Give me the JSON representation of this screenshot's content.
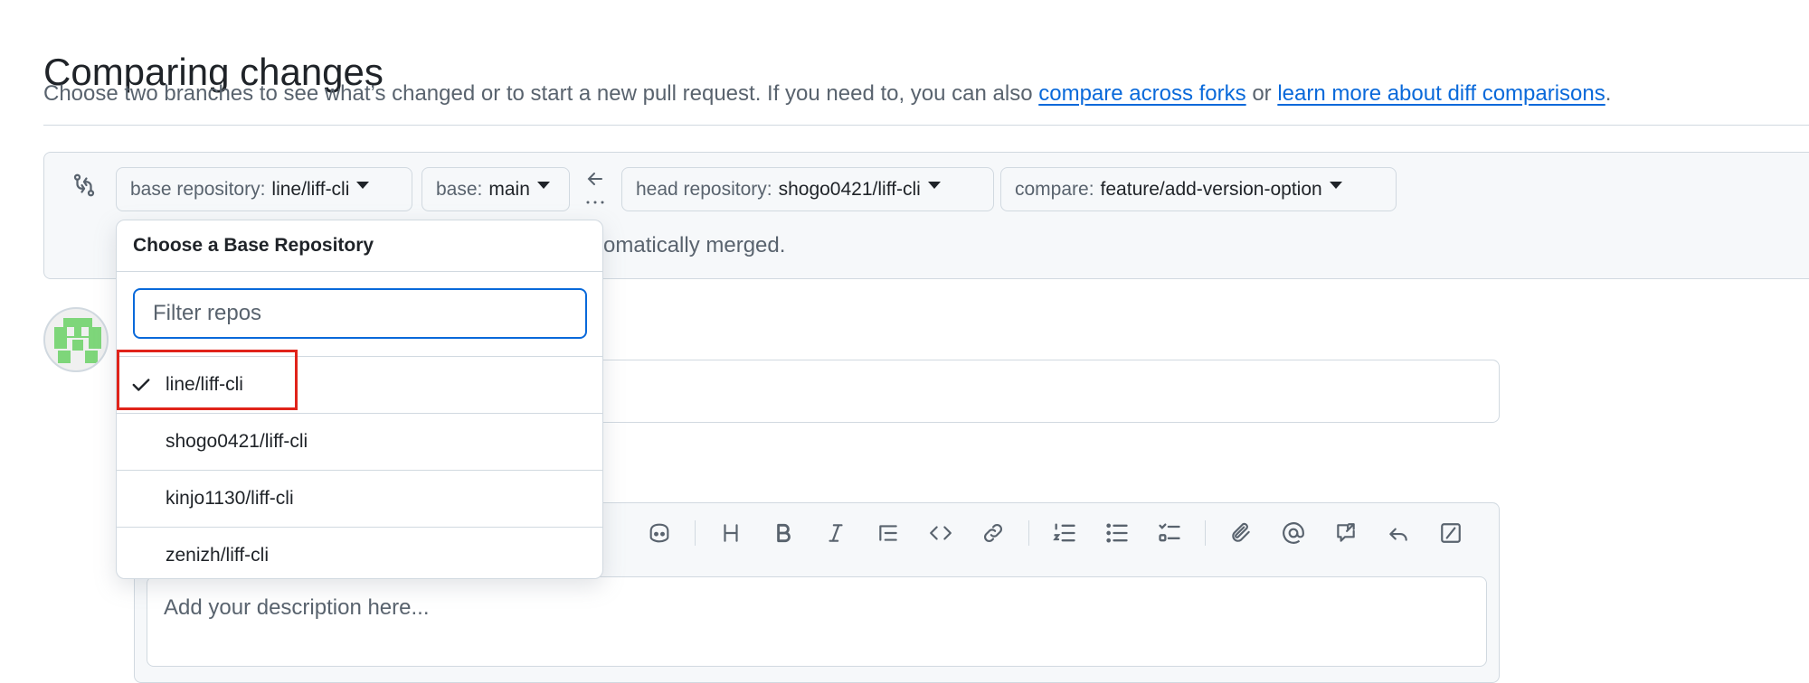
{
  "page": {
    "title": "Comparing changes",
    "subtitle_text": "Choose two branches to see what’s changed or to start a new pull request. If you need to, you can also",
    "link_forks": "compare across forks",
    "subtitle_or": "or",
    "link_learn": "learn more about diff comparisons",
    "subtitle_end": "."
  },
  "compare": {
    "base_repo_label": "base repository:",
    "base_repo_value": "line/liff-cli",
    "base_label": "base:",
    "base_value": "main",
    "head_repo_label": "head repository:",
    "head_repo_value": "shogo0421/liff-cli",
    "compare_label": "compare:",
    "compare_value": "feature/add-version-option",
    "merge_message": "omatically merged."
  },
  "dropdown": {
    "header": "Choose a Base Repository",
    "filter_placeholder": "Filter repos",
    "items": [
      {
        "label": "line/liff-cli",
        "selected": true
      },
      {
        "label": "shogo0421/liff-cli",
        "selected": false
      },
      {
        "label": "kinjo1130/liff-cli",
        "selected": false
      },
      {
        "label": "zenizh/liff-cli",
        "selected": false
      }
    ]
  },
  "editor": {
    "description_placeholder": "Add your description here...",
    "toolbar_icons": [
      "copilot-icon",
      "heading-icon",
      "bold-icon",
      "italic-icon",
      "quote-icon",
      "code-icon",
      "link-icon",
      "ordered-list-icon",
      "unordered-list-icon",
      "task-list-icon",
      "attach-icon",
      "mention-icon",
      "reference-icon",
      "reply-icon",
      "slash-command-icon"
    ]
  },
  "colors": {
    "link": "#0969da",
    "highlight": "#e0231a",
    "avatar": "#7ed67a"
  }
}
